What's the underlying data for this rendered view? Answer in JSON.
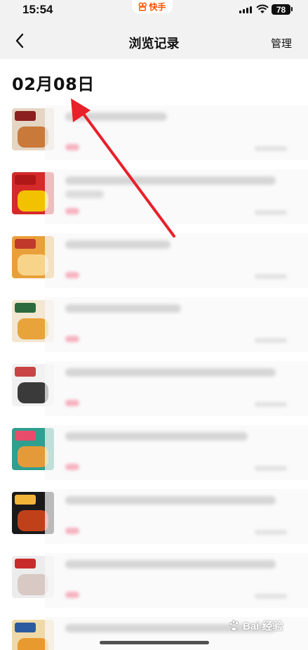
{
  "status_bar": {
    "time": "15:54",
    "app_badge": "快手",
    "battery": "78"
  },
  "nav": {
    "back_icon": "chevron-left-icon",
    "title": "浏览记录",
    "manage_label": "管理"
  },
  "date_header": "02月08日",
  "annotation": {
    "type": "red-arrow",
    "color": "#e8202a",
    "points_to": "date_header"
  },
  "items": [
    {
      "thumb_colors": [
        "#e5d6c4",
        "#c97a3a",
        "#8b1f1f"
      ]
    },
    {
      "thumb_colors": [
        "#d42a2a",
        "#f2c200",
        "#b01818"
      ]
    },
    {
      "thumb_colors": [
        "#e9a03a",
        "#f7d48a",
        "#c0392b"
      ]
    },
    {
      "thumb_colors": [
        "#f3e7d2",
        "#e8a33b",
        "#2d6a3e"
      ]
    },
    {
      "thumb_colors": [
        "#f1f1f1",
        "#3a3a3a",
        "#c94444"
      ]
    },
    {
      "thumb_colors": [
        "#2f9f8f",
        "#e59a3a",
        "#e94c6b"
      ]
    },
    {
      "thumb_colors": [
        "#1a1a1a",
        "#c0401a",
        "#f2b53a"
      ]
    },
    {
      "thumb_colors": [
        "#ececec",
        "#d8c9c4",
        "#c92b2b"
      ]
    },
    {
      "thumb_colors": [
        "#f0d9a8",
        "#e89a2e",
        "#2c5aa0"
      ]
    }
  ],
  "watermark": "Bai 经验",
  "colors": {
    "nav_bg": "#f2f2f2",
    "price_pink": "#f5b2bf",
    "brand_orange": "#ff5000"
  }
}
